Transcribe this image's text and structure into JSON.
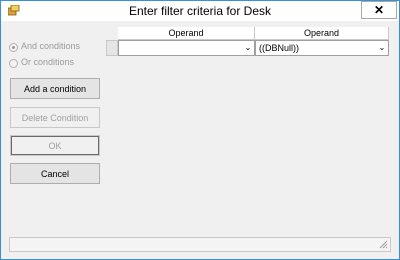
{
  "window": {
    "title": "Enter filter criteria for Desk",
    "close_label": "✕",
    "icon": "app-icon"
  },
  "conditions": {
    "and_label": "And conditions",
    "or_label": "Or conditions",
    "selected": "and"
  },
  "buttons": {
    "add": "Add a condition",
    "delete": "Delete Condition",
    "ok": "OK",
    "cancel": "Cancel"
  },
  "grid": {
    "columns": [
      "Operand",
      "Operand"
    ],
    "rows": [
      {
        "left_value": "",
        "right_value": "((DBNull))"
      }
    ]
  },
  "colors": {
    "window_border": "#3a8fd6",
    "client_bg": "#f0f0f0",
    "disabled_text": "#a0a0a0"
  }
}
